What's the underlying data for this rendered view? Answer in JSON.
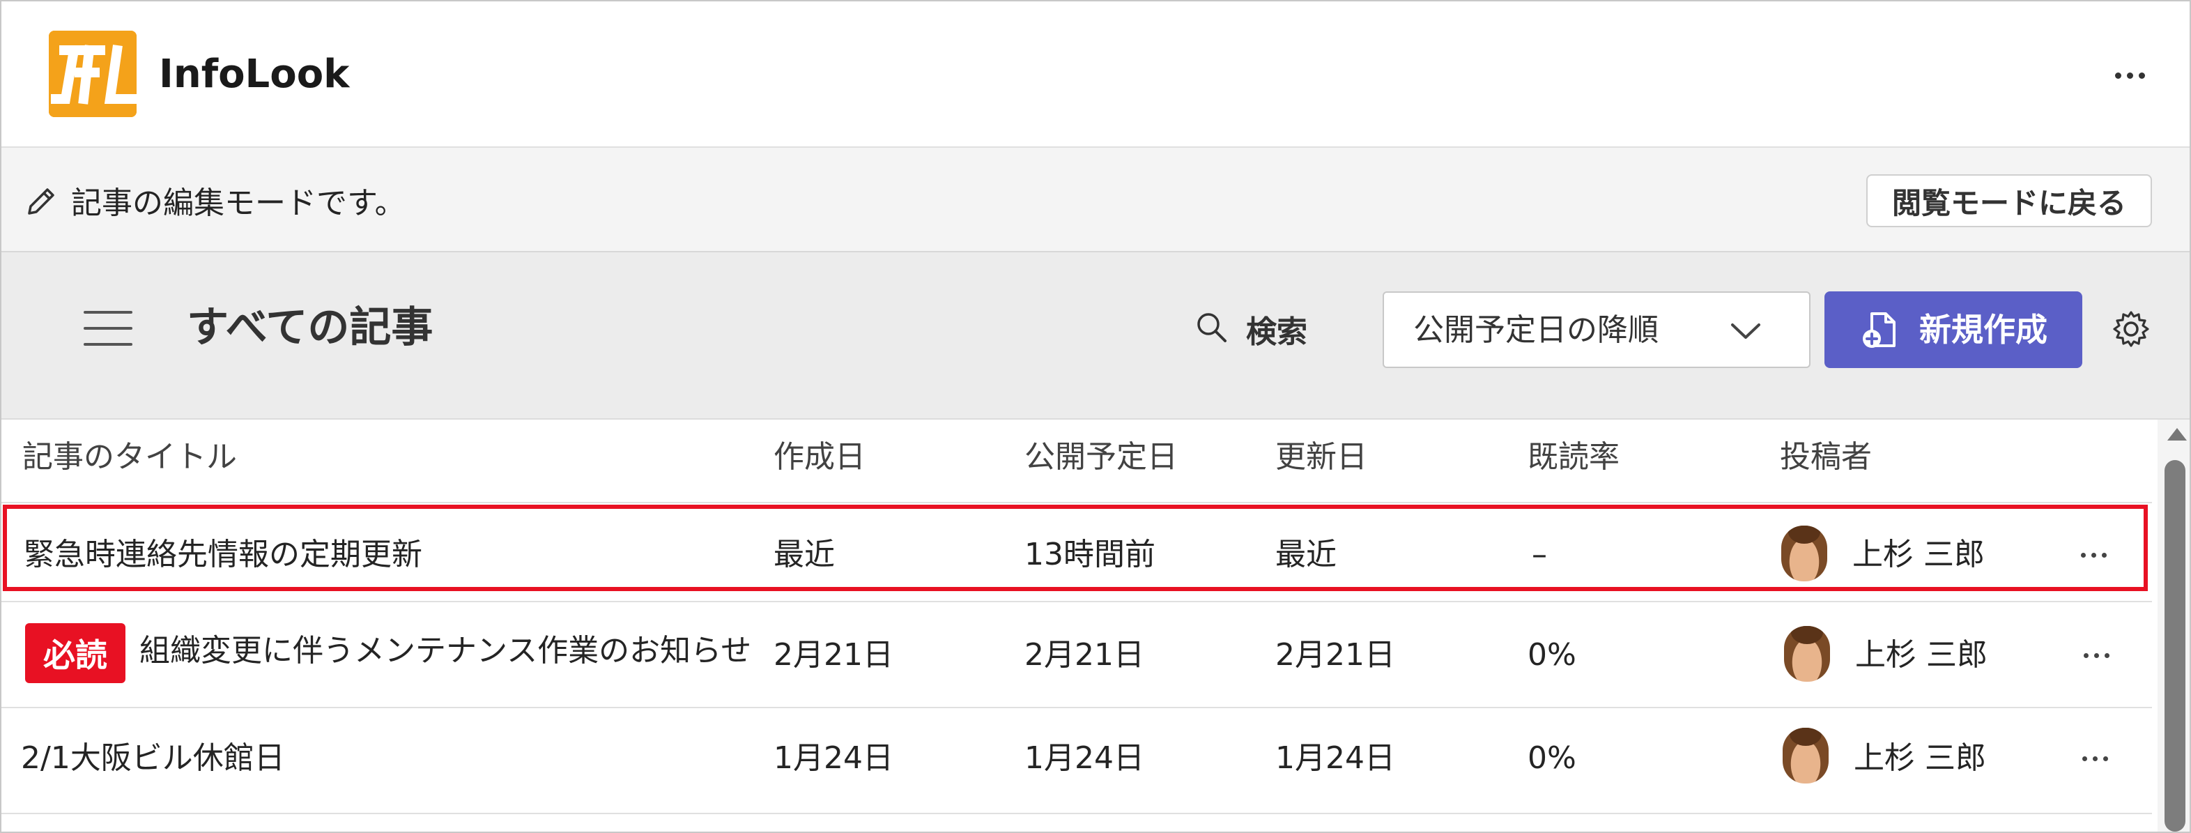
{
  "app": {
    "title": "InfoLook",
    "logo_text": "IfL",
    "more_icon": "more-horizontal-icon",
    "brand_color": "#f4a21a"
  },
  "edit_banner": {
    "icon": "pencil-icon",
    "message": "記事の編集モードです。",
    "view_mode_button": "閲覧モードに戻る"
  },
  "toolbar": {
    "menu_icon": "hamburger-icon",
    "page_title": "すべての記事",
    "search_icon": "search-icon",
    "search_label": "検索",
    "sort_selected": "公開予定日の降順",
    "sort_icon": "chevron-down-icon",
    "new_button": "新規作成",
    "new_icon": "new-document-icon",
    "new_button_color": "#5b5fc7",
    "settings_icon": "gear-icon"
  },
  "table": {
    "columns": [
      "記事のタイトル",
      "作成日",
      "公開予定日",
      "更新日",
      "既読率",
      "投稿者"
    ],
    "rows": [
      {
        "title": "緊急時連絡先情報の定期更新",
        "badge": "",
        "created": "最近",
        "scheduled": "13時間前",
        "updated": "最近",
        "read_rate": "–",
        "author": "上杉 三郎",
        "highlighted": true
      },
      {
        "title": "組織変更に伴うメンテナンス作業のお知らせ",
        "badge": "必読",
        "created": "2月21日",
        "scheduled": "2月21日",
        "updated": "2月21日",
        "read_rate": "0%",
        "author": "上杉 三郎",
        "highlighted": false
      },
      {
        "title": "2/1大阪ビル休館日",
        "badge": "",
        "created": "1月24日",
        "scheduled": "1月24日",
        "updated": "1月24日",
        "read_rate": "0%",
        "author": "上杉 三郎",
        "highlighted": false
      }
    ],
    "highlight_color": "#e81123",
    "badge_color": "#e81123"
  }
}
